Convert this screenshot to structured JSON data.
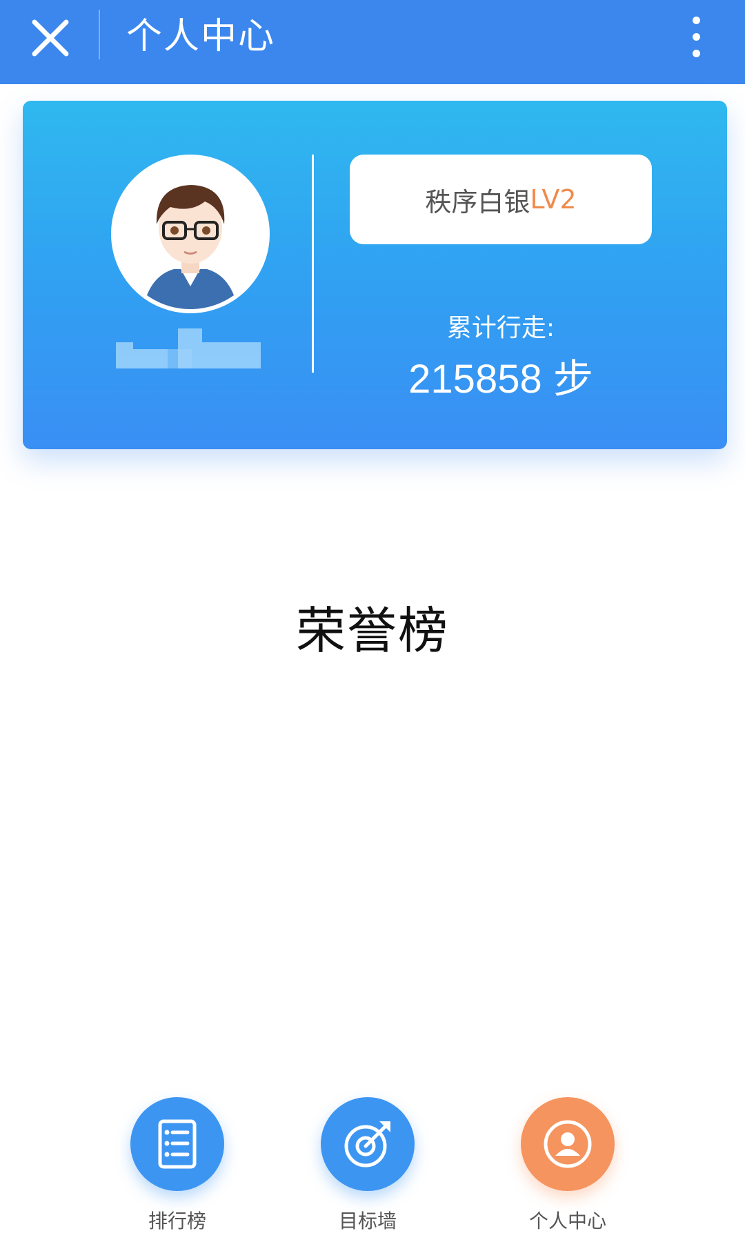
{
  "header": {
    "title": "个人中心",
    "close_icon": "close-icon",
    "more_icon": "more-vertical-icon",
    "color": "#3b87ee"
  },
  "profile": {
    "avatar_icon": "avatar-cartoon",
    "level_name": "秩序白银",
    "level_tag": "LV2",
    "walk_label": "累计行走:",
    "walk_value": "215858 步"
  },
  "main": {
    "honor_title": "荣誉榜"
  },
  "bottom_nav": [
    {
      "label": "排行榜",
      "icon": "list-icon",
      "color": "#3d95f2"
    },
    {
      "label": "目标墙",
      "icon": "target-icon",
      "color": "#3d95f2"
    },
    {
      "label": "个人中心",
      "icon": "user-icon",
      "color": "#f5945f"
    }
  ]
}
